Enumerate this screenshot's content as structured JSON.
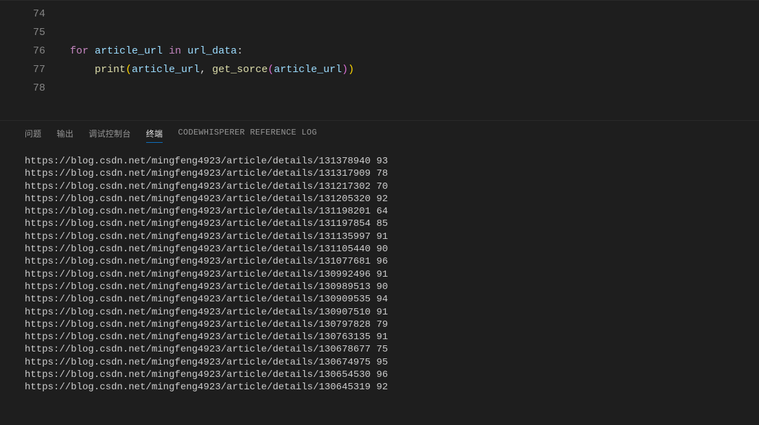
{
  "editor": {
    "lines": [
      {
        "num": "74",
        "tokens": []
      },
      {
        "num": "75",
        "tokens": []
      },
      {
        "num": "76",
        "tokens": [
          {
            "t": "for ",
            "c": "tok-kw"
          },
          {
            "t": "article_url",
            "c": "tok-var"
          },
          {
            "t": " in ",
            "c": "tok-kw"
          },
          {
            "t": "url_data",
            "c": "tok-var"
          },
          {
            "t": ":",
            "c": "tok-punc"
          }
        ]
      },
      {
        "num": "77",
        "tokens": [
          {
            "t": "    ",
            "c": ""
          },
          {
            "t": "print",
            "c": "tok-fn"
          },
          {
            "t": "(",
            "c": "tok-par"
          },
          {
            "t": "article_url",
            "c": "tok-var"
          },
          {
            "t": ", ",
            "c": "tok-punc"
          },
          {
            "t": "get_sorce",
            "c": "tok-call"
          },
          {
            "t": "(",
            "c": "tok-par2"
          },
          {
            "t": "article_url",
            "c": "tok-var"
          },
          {
            "t": ")",
            "c": "tok-par2"
          },
          {
            "t": ")",
            "c": "tok-par"
          }
        ]
      },
      {
        "num": "78",
        "tokens": []
      }
    ]
  },
  "panel": {
    "tabs": {
      "problems": "问题",
      "output": "输出",
      "debug_console": "调试控制台",
      "terminal": "终端",
      "codewhisperer": "CODEWHISPERER REFERENCE LOG"
    },
    "active_tab": "terminal",
    "terminal_lines": [
      {
        "url": "https://blog.csdn.net/mingfeng4923/article/details/131378940",
        "score": "93"
      },
      {
        "url": "https://blog.csdn.net/mingfeng4923/article/details/131317909",
        "score": "78"
      },
      {
        "url": "https://blog.csdn.net/mingfeng4923/article/details/131217302",
        "score": "70"
      },
      {
        "url": "https://blog.csdn.net/mingfeng4923/article/details/131205320",
        "score": "92"
      },
      {
        "url": "https://blog.csdn.net/mingfeng4923/article/details/131198201",
        "score": "64"
      },
      {
        "url": "https://blog.csdn.net/mingfeng4923/article/details/131197854",
        "score": "85"
      },
      {
        "url": "https://blog.csdn.net/mingfeng4923/article/details/131135997",
        "score": "91"
      },
      {
        "url": "https://blog.csdn.net/mingfeng4923/article/details/131105440",
        "score": "90"
      },
      {
        "url": "https://blog.csdn.net/mingfeng4923/article/details/131077681",
        "score": "96"
      },
      {
        "url": "https://blog.csdn.net/mingfeng4923/article/details/130992496",
        "score": "91"
      },
      {
        "url": "https://blog.csdn.net/mingfeng4923/article/details/130989513",
        "score": "90"
      },
      {
        "url": "https://blog.csdn.net/mingfeng4923/article/details/130909535",
        "score": "94"
      },
      {
        "url": "https://blog.csdn.net/mingfeng4923/article/details/130907510",
        "score": "91"
      },
      {
        "url": "https://blog.csdn.net/mingfeng4923/article/details/130797828",
        "score": "79"
      },
      {
        "url": "https://blog.csdn.net/mingfeng4923/article/details/130763135",
        "score": "91"
      },
      {
        "url": "https://blog.csdn.net/mingfeng4923/article/details/130678677",
        "score": "75"
      },
      {
        "url": "https://blog.csdn.net/mingfeng4923/article/details/130674975",
        "score": "95"
      },
      {
        "url": "https://blog.csdn.net/mingfeng4923/article/details/130654530",
        "score": "96"
      },
      {
        "url": "https://blog.csdn.net/mingfeng4923/article/details/130645319",
        "score": "92"
      }
    ]
  }
}
